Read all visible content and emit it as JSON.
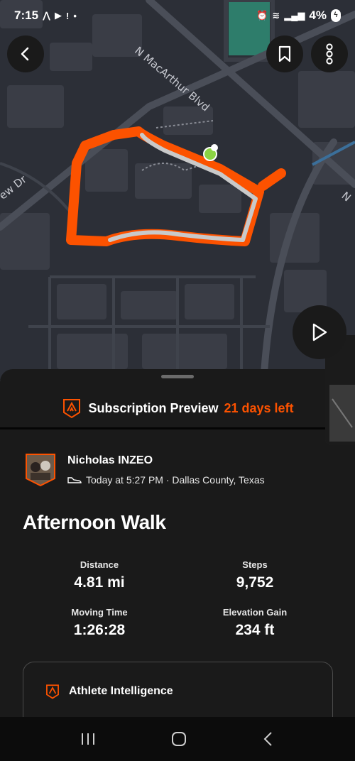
{
  "status_bar": {
    "time": "7:15",
    "battery": "4%"
  },
  "map": {
    "street_labels": [
      "N MacArthur Blvd",
      "ew Dr",
      "N"
    ]
  },
  "buttons": {
    "back_icon": "back-arrow-icon",
    "bookmark_icon": "bookmark-icon",
    "more_icon": "more-vertical-icon",
    "play_icon": "play-icon"
  },
  "subscription": {
    "title": "Subscription Preview",
    "days_left": "21 days left"
  },
  "athlete": {
    "name": "Nicholas INZEO",
    "meta": "Today at 5:27 PM · Dallas County, Texas"
  },
  "activity": {
    "title": "Afternoon Walk",
    "stats": [
      {
        "label": "Distance",
        "value": "4.81 mi"
      },
      {
        "label": "Steps",
        "value": "9,752"
      },
      {
        "label": "Moving Time",
        "value": "1:26:28"
      },
      {
        "label": "Elevation Gain",
        "value": "234 ft"
      }
    ]
  },
  "athlete_intelligence": {
    "title": "Athlete Intelligence"
  },
  "colors": {
    "accent": "#fc5200",
    "sheet": "#1a1a1a",
    "map": "#2c2f37"
  }
}
